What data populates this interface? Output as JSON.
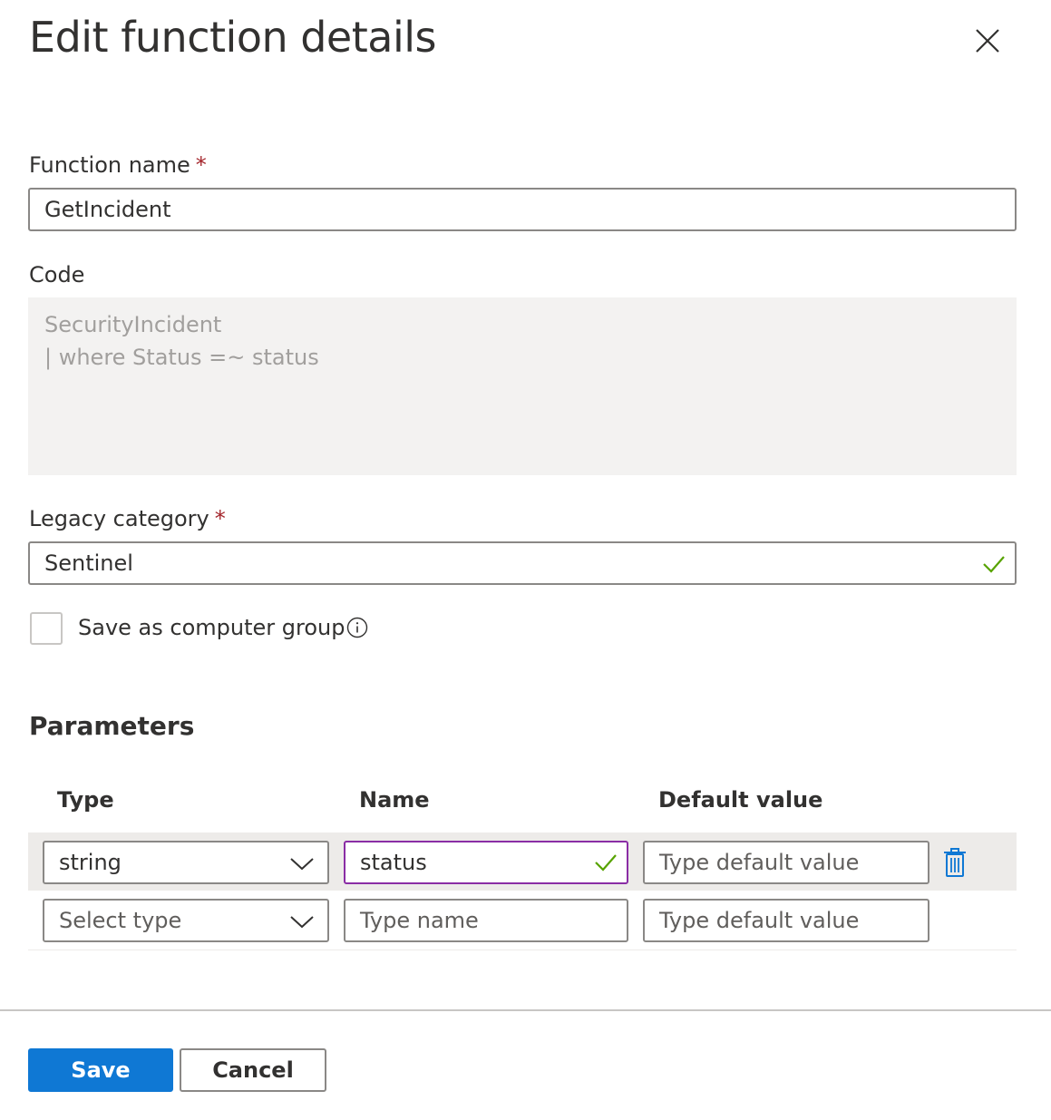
{
  "dialog": {
    "title": "Edit function details"
  },
  "function_name": {
    "label": "Function name",
    "required_mark": "*",
    "value": "GetIncident"
  },
  "code": {
    "label": "Code",
    "lines": [
      "SecurityIncident",
      "| where Status =~ status"
    ]
  },
  "legacy_category": {
    "label": "Legacy category",
    "required_mark": "*",
    "value": "Sentinel",
    "valid": true
  },
  "computer_group": {
    "label": "Save as computer group",
    "checked": false,
    "info_icon": "info-icon"
  },
  "parameters": {
    "title": "Parameters",
    "columns": [
      "Type",
      "Name",
      "Default value"
    ],
    "rows": [
      {
        "type": "string",
        "name": "status",
        "default_placeholder": "Type default value",
        "name_valid": true
      },
      {
        "type_placeholder": "Select type",
        "name_placeholder": "Type name",
        "default_placeholder": "Type default value"
      }
    ]
  },
  "footer": {
    "save_label": "Save",
    "cancel_label": "Cancel"
  },
  "colors": {
    "primary": "#0f78d4",
    "required": "#a4262c",
    "valid_check": "#57a300",
    "focus_border": "#8a2da5",
    "delete_icon": "#0f78d4"
  }
}
